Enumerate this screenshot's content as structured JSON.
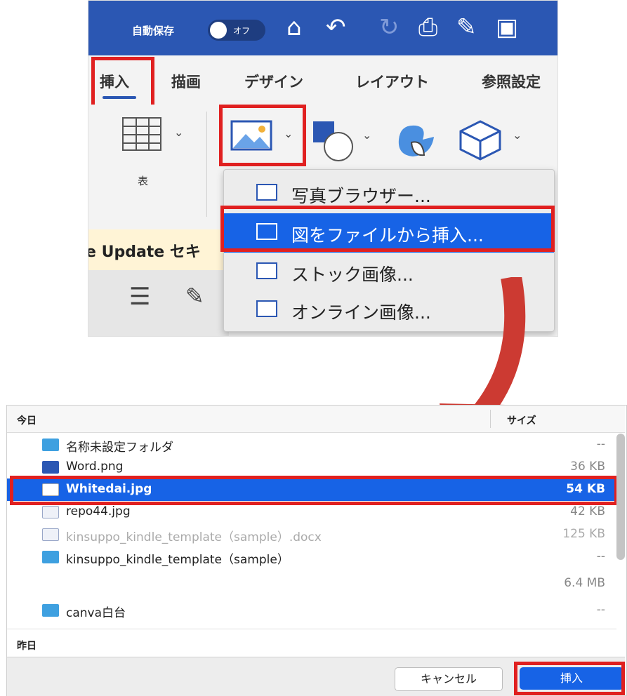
{
  "word": {
    "autosave_label": "自動保存",
    "autosave_state": "オフ",
    "tabs": [
      {
        "label": "挿入"
      },
      {
        "label": "描画"
      },
      {
        "label": "デザイン"
      },
      {
        "label": "レイアウト"
      },
      {
        "label": "参照設定"
      }
    ],
    "table_label": "表",
    "picture_menu": [
      {
        "label": "写真ブラウザー..."
      },
      {
        "label": "図をファイルから挿入..."
      },
      {
        "label": "ストック画像..."
      },
      {
        "label": "オンライン画像..."
      }
    ],
    "update_bar_text": "e Update セキ"
  },
  "dialog": {
    "col_name": "今日",
    "col_size": "サイズ",
    "rows": [
      {
        "name": "名称未設定フォルダ",
        "size": "--"
      },
      {
        "name": "Word.png",
        "size": "36 KB"
      },
      {
        "name": "Whitedai.jpg",
        "size": "54 KB"
      },
      {
        "name": "repo44.jpg",
        "size": "42 KB"
      },
      {
        "name": "kinsuppo_kindle_template（sample）.docx",
        "size": "125 KB"
      },
      {
        "name": "kinsuppo_kindle_template（sample）",
        "size": "--"
      },
      {
        "name": "",
        "size": "6.4 MB"
      },
      {
        "name": "canva白台",
        "size": "--"
      }
    ],
    "section_yesterday": "昨日",
    "cancel_label": "キャンセル",
    "insert_label": "挿入"
  },
  "colors": {
    "accent": "#1763e6",
    "highlight": "#e02020",
    "titlebar": "#2b57b3"
  }
}
